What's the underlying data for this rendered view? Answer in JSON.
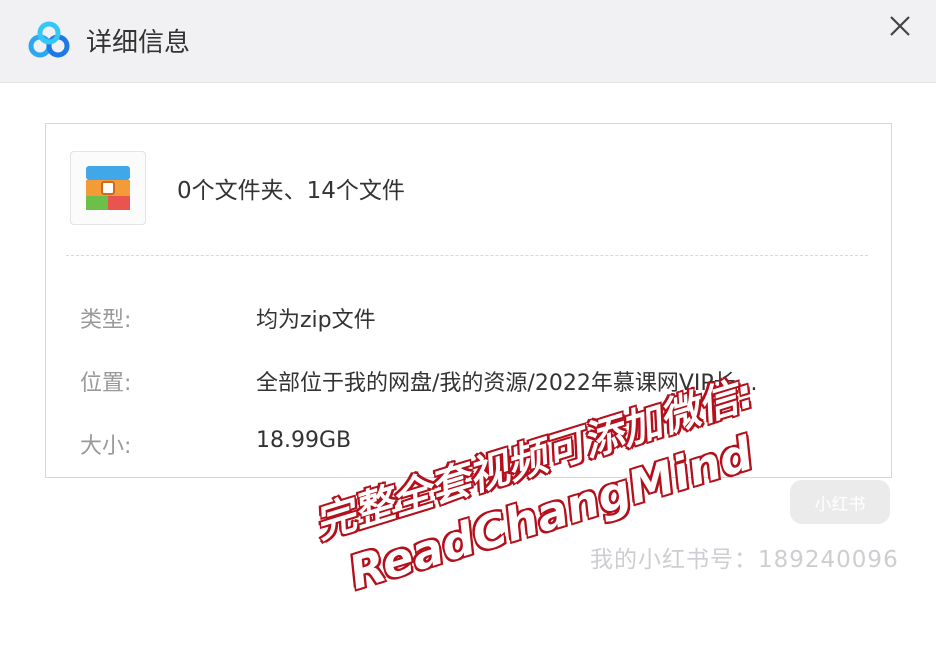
{
  "window": {
    "title": "详细信息"
  },
  "summary": "0个文件夹、14个文件",
  "details": {
    "type_label": "类型:",
    "type_value": "均为zip文件",
    "location_label": "位置:",
    "location_value": "全部位于我的网盘/我的资源/2022年慕课网VIP长…",
    "size_label": "大小:",
    "size_value": "18.99GB"
  },
  "overlay": {
    "line1": "完整全套视频可添加微信:",
    "line2": "ReadChangMind"
  },
  "watermark": {
    "text": "我的小红书号：189240096",
    "logo": "小红书"
  },
  "icons": {
    "app": "baidu-netdisk-cloud-icon",
    "file": "archive-zip-icon",
    "close": "close-icon"
  },
  "colors": {
    "titlebar": "#f1f1f3",
    "overlay_stroke": "#b4101c",
    "label": "#999999",
    "value": "#333333"
  }
}
